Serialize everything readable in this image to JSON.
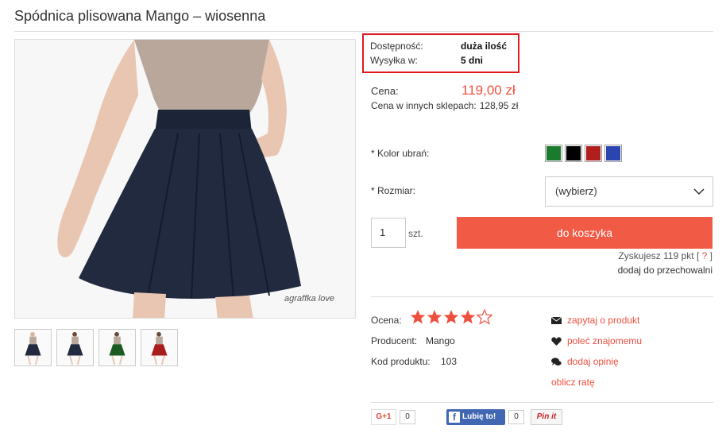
{
  "product": {
    "title": "Spódnica plisowana Mango – wiosenna"
  },
  "image": {
    "watermark": "agraffka love"
  },
  "availability": {
    "stock_label": "Dostępność:",
    "stock_value": "duża ilość",
    "shipping_label": "Wysyłka w:",
    "shipping_value": "5 dni"
  },
  "price": {
    "label": "Cena:",
    "value": "119,00 zł",
    "other_label": "Cena w innych sklepach:",
    "other_value": "128,95 zł"
  },
  "options": {
    "color_label": "* Kolor ubrań:",
    "colors": [
      "#1b7a2e",
      "#000000",
      "#b01e1e",
      "#2a44b0"
    ],
    "size_label": "* Rozmiar:",
    "size_value": "(wybierz)"
  },
  "cart": {
    "quantity": "1",
    "unit": "szt.",
    "button": "do koszyka"
  },
  "points": {
    "text": "Zyskujesz 119 pkt [",
    "help": "?",
    "close": "]",
    "store": "dodaj do przechowalni"
  },
  "details": {
    "rating_label": "Ocena:",
    "rating": 4,
    "rating_max": 5,
    "producer_label": "Producent:",
    "producer_value": "Mango",
    "code_label": "Kod produktu:",
    "code_value": "103"
  },
  "actions": {
    "ask": "zapytaj o produkt",
    "recommend": "poleć znajomemu",
    "review": "dodaj opinię",
    "installment": "oblicz ratę"
  },
  "social": {
    "gplus": "G+1",
    "gplus_count": "0",
    "fb": "Lubię to!",
    "fb_count": "0",
    "pin": "Pin it"
  }
}
